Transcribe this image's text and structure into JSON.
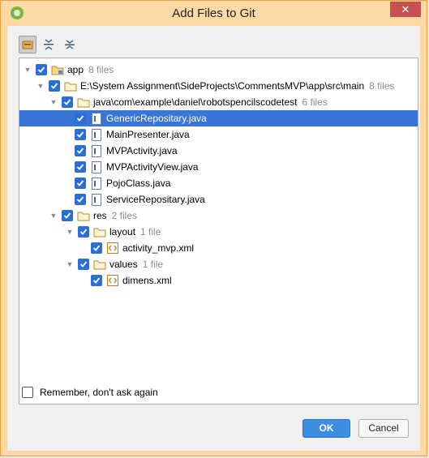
{
  "window": {
    "title": "Add Files to Git",
    "close_glyph": "✕"
  },
  "toolbar": {
    "buttons": [
      {
        "icon": "group-by-directory-icon"
      },
      {
        "icon": "expand-all-icon"
      },
      {
        "icon": "collapse-all-icon"
      }
    ]
  },
  "tree": {
    "app": {
      "label": "app",
      "count": "8 files"
    },
    "path": {
      "label": "E:\\System Assignment\\SideProjects\\CommentsMVP\\app\\src\\main",
      "count": "8 files"
    },
    "pkg": {
      "label": "java\\com\\example\\daniel\\robotspencilscodetest",
      "count": "6 files"
    },
    "files": [
      {
        "label": "GenericRepositary.java",
        "selected": true
      },
      {
        "label": "MainPresenter.java",
        "selected": false
      },
      {
        "label": "MVPActivity.java",
        "selected": false
      },
      {
        "label": "MVPActivityView.java",
        "selected": false
      },
      {
        "label": "PojoClass.java",
        "selected": false
      },
      {
        "label": "ServiceRepositary.java",
        "selected": false
      }
    ],
    "res": {
      "label": "res",
      "count": "2 files"
    },
    "layout": {
      "label": "layout",
      "count": "1 file"
    },
    "layout_file": {
      "label": "activity_mvp.xml"
    },
    "values": {
      "label": "values",
      "count": "1 file"
    },
    "values_file": {
      "label": "dimens.xml"
    }
  },
  "footer": {
    "remember_label": "Remember, don't ask again",
    "remember_checked": false,
    "ok_label": "OK",
    "cancel_label": "Cancel"
  },
  "colors": {
    "accent": "#2b6fd6",
    "selection": "#3875d7",
    "titlebar": "#fdd9a6"
  }
}
